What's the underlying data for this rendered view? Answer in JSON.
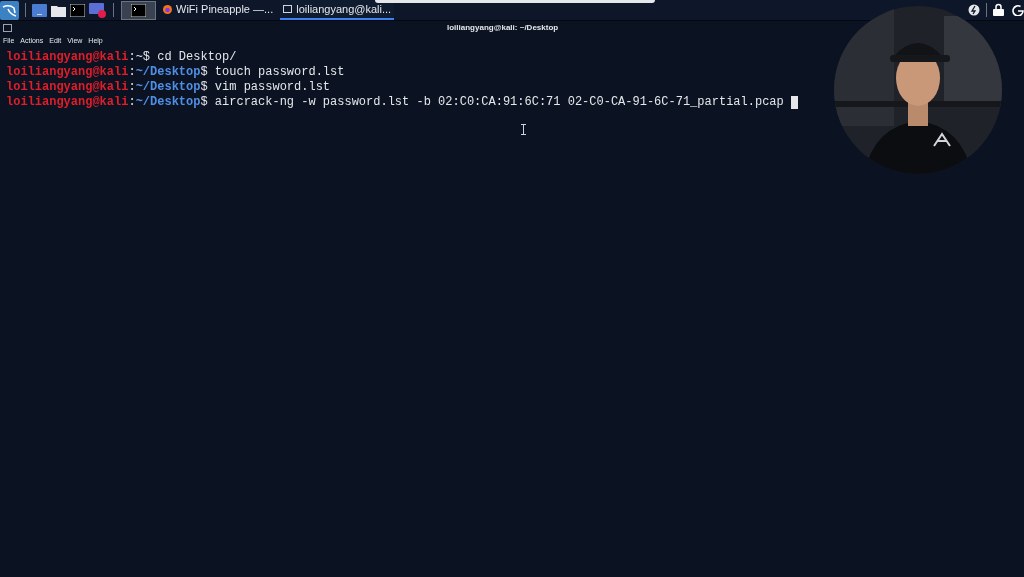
{
  "taskbar": {
    "tasks": [
      {
        "kind": "firefox",
        "label": "WiFi Pineapple —...",
        "selected": false
      },
      {
        "kind": "terminal",
        "label": "loiliangyang@kali...",
        "selected": true
      }
    ]
  },
  "window": {
    "title": "loiliangyang@kali: ~/Desktop"
  },
  "menu": [
    "File",
    "Actions",
    "Edit",
    "View",
    "Help"
  ],
  "terminal": {
    "lines": [
      {
        "user": "loiliangyang@kali",
        "separator": ":",
        "path": "~",
        "path_highlighted": false,
        "prompt": "$",
        "command": "cd Desktop/",
        "cursor": false
      },
      {
        "user": "loiliangyang@kali",
        "separator": ":",
        "path": "~/Desktop",
        "path_highlighted": true,
        "prompt": "$",
        "command": "touch password.lst",
        "cursor": false
      },
      {
        "user": "loiliangyang@kali",
        "separator": ":",
        "path": "~/Desktop",
        "path_highlighted": true,
        "prompt": "$",
        "command": "vim password.lst",
        "cursor": false
      },
      {
        "user": "loiliangyang@kali",
        "separator": ":",
        "path": "~/Desktop",
        "path_highlighted": true,
        "prompt": "$",
        "command": "aircrack-ng -w password.lst -b 02:C0:CA:91:6C:71 02-C0-CA-91-6C-71_partial.pcap",
        "cursor": true
      }
    ]
  }
}
